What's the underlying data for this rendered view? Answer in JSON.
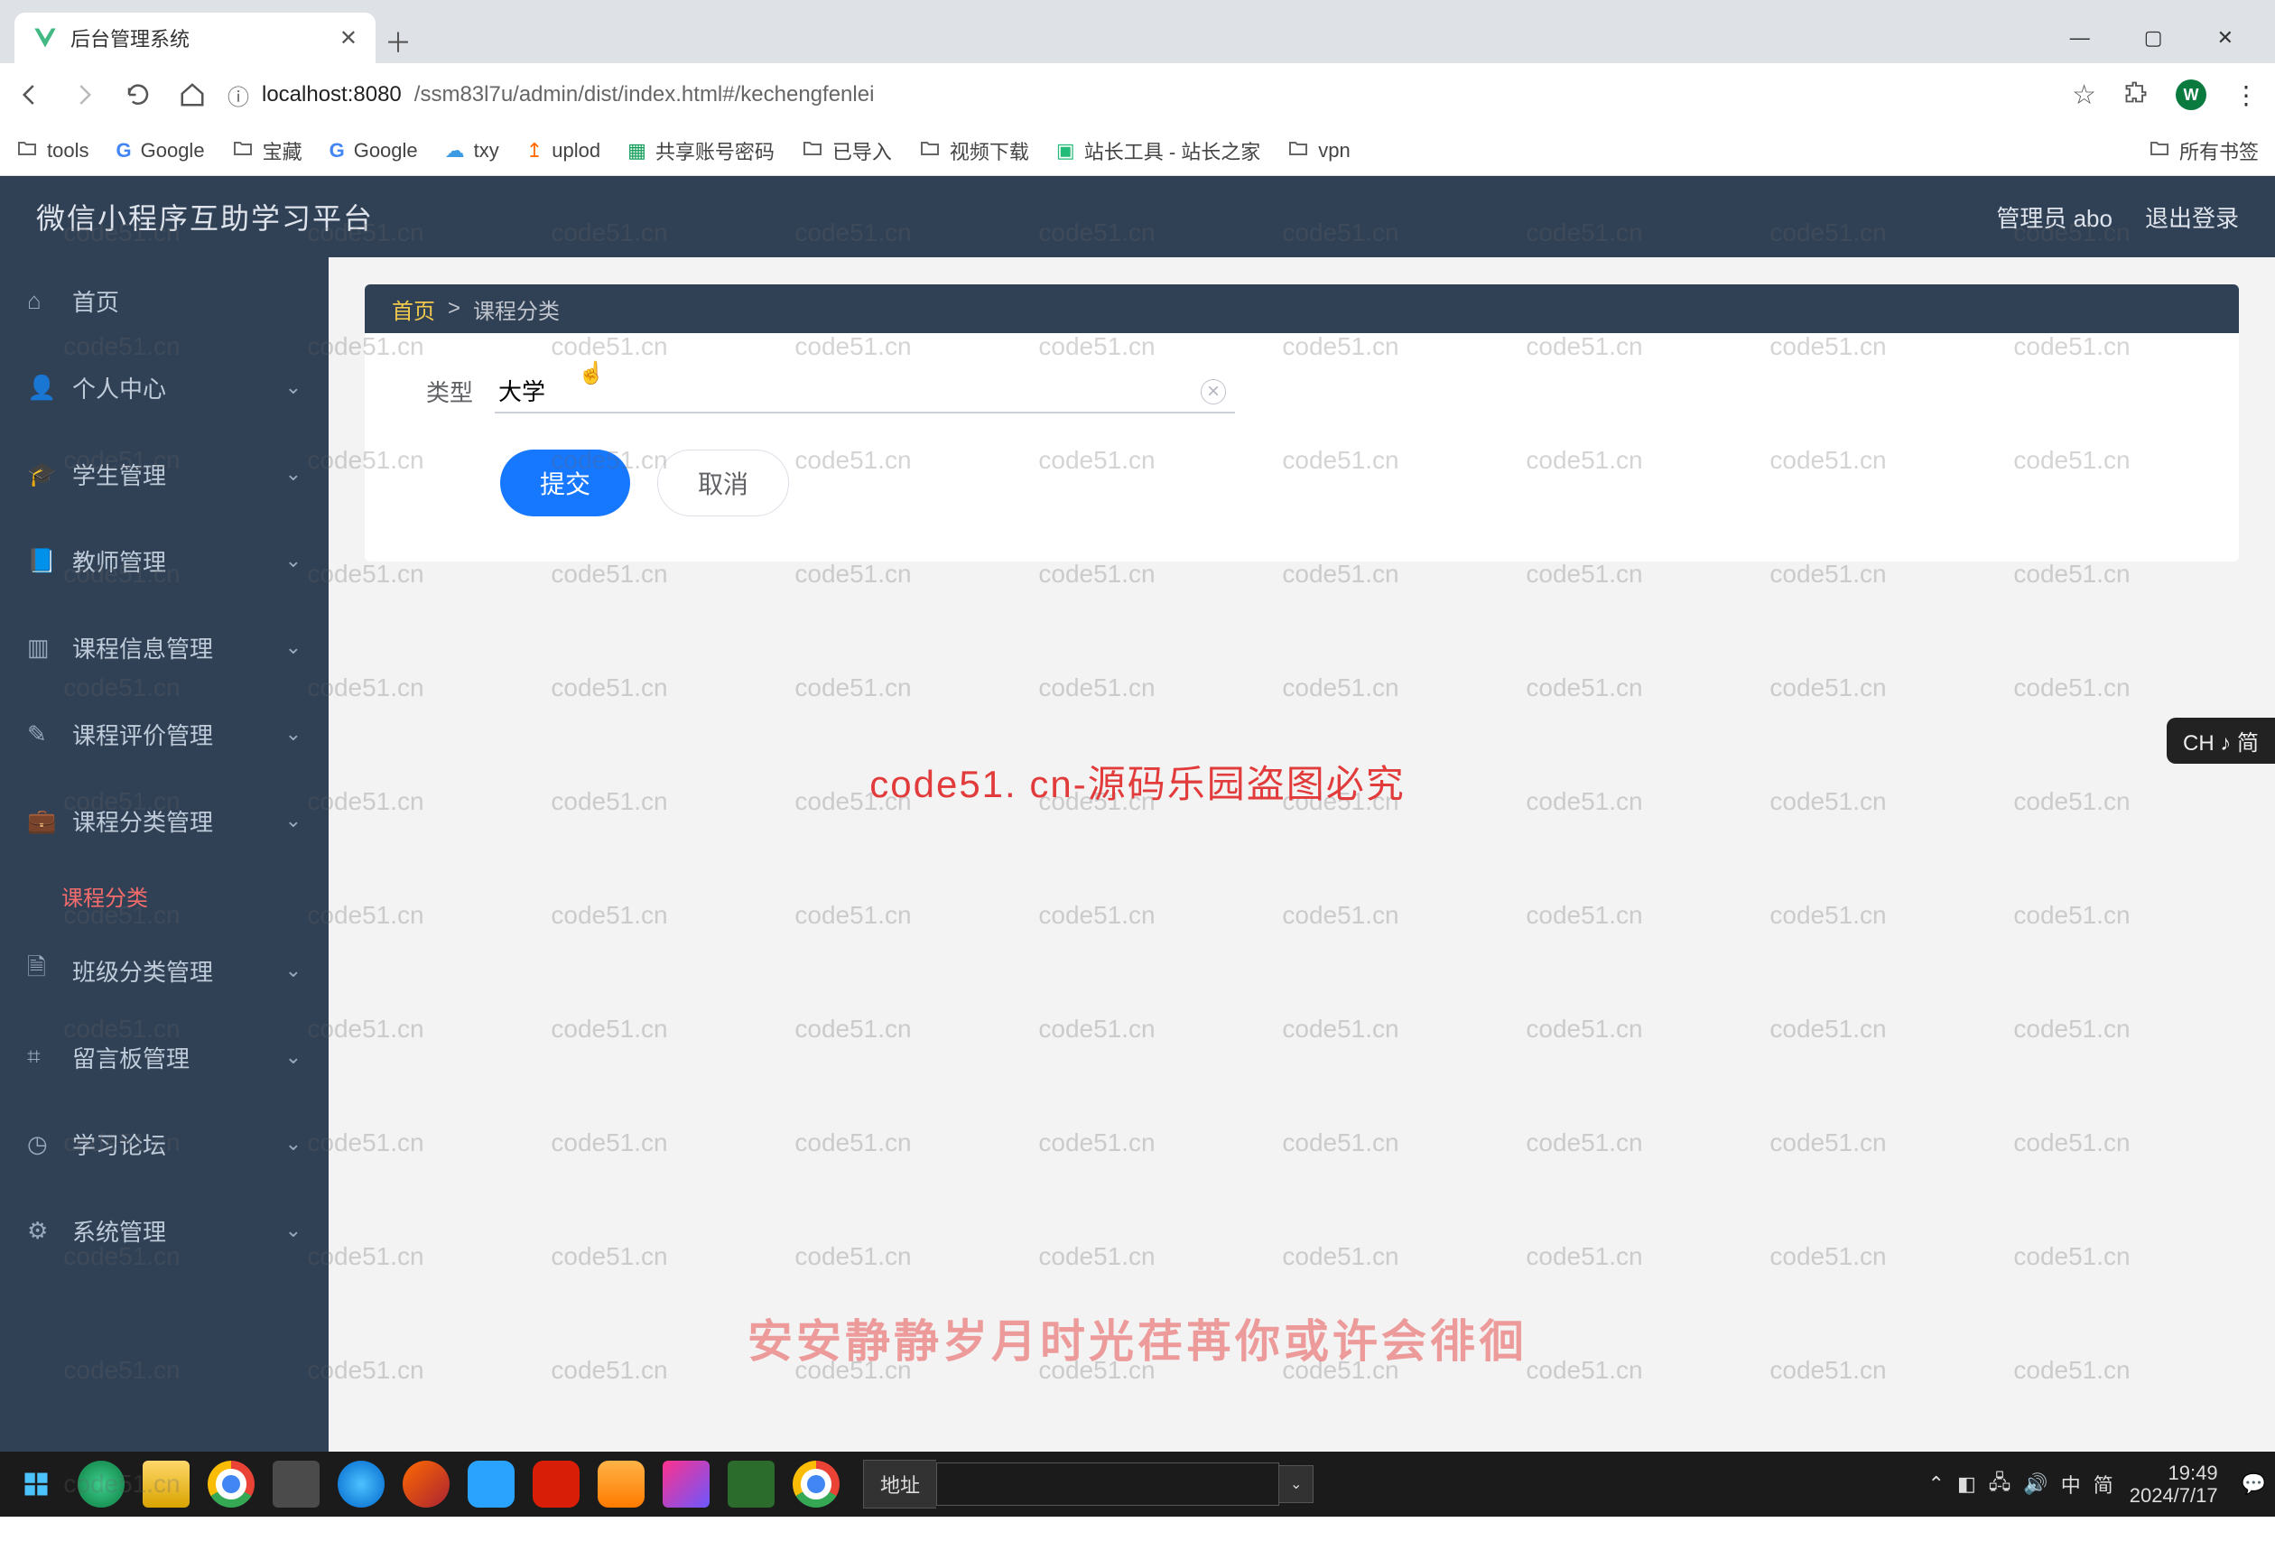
{
  "browser": {
    "tab_title": "后台管理系统",
    "url_host": "localhost:8080",
    "url_path": "/ssm83l7u/admin/dist/index.html#/kechengfenlei",
    "avatar_initial": "W",
    "bookmarks": [
      {
        "icon": "folder",
        "label": "tools"
      },
      {
        "icon": "google-g",
        "label": "Google"
      },
      {
        "icon": "folder",
        "label": "宝藏"
      },
      {
        "icon": "google-g",
        "label": "Google"
      },
      {
        "icon": "cloud",
        "label": "txy"
      },
      {
        "icon": "upload",
        "label": "uplod"
      },
      {
        "icon": "sheet",
        "label": "共享账号密码"
      },
      {
        "icon": "folder",
        "label": "已导入"
      },
      {
        "icon": "folder",
        "label": "视频下载"
      },
      {
        "icon": "site-tool",
        "label": "站长工具 - 站长之家"
      },
      {
        "icon": "folder",
        "label": "vpn"
      }
    ],
    "bookmarks_right": {
      "icon": "folder",
      "label": "所有书签"
    }
  },
  "app": {
    "title": "微信小程序互助学习平台",
    "header_user": "管理员 abo",
    "header_logout": "退出登录",
    "breadcrumb_home": "首页",
    "breadcrumb_sep": ">",
    "breadcrumb_current": "课程分类",
    "sidebar": [
      {
        "icon": "home",
        "label": "首页",
        "expandable": false
      },
      {
        "icon": "user",
        "label": "个人中心",
        "expandable": true
      },
      {
        "icon": "student",
        "label": "学生管理",
        "expandable": true
      },
      {
        "icon": "teacher",
        "label": "教师管理",
        "expandable": true
      },
      {
        "icon": "chart",
        "label": "课程信息管理",
        "expandable": true
      },
      {
        "icon": "review",
        "label": "课程评价管理",
        "expandable": true
      },
      {
        "icon": "case",
        "label": "课程分类管理",
        "expandable": true,
        "expanded": true,
        "children": [
          {
            "label": "课程分类",
            "active": true
          }
        ]
      },
      {
        "icon": "doc",
        "label": "班级分类管理",
        "expandable": true
      },
      {
        "icon": "message",
        "label": "留言板管理",
        "expandable": true
      },
      {
        "icon": "clock",
        "label": "学习论坛",
        "expandable": true
      },
      {
        "icon": "gear",
        "label": "系统管理",
        "expandable": true
      }
    ],
    "form": {
      "label_type": "类型",
      "input_value": "大学",
      "submit": "提交",
      "cancel": "取消"
    },
    "ime_badge": "CH ♪ 简"
  },
  "watermark": {
    "tile": "code51.cn",
    "center": "code51. cn-源码乐园盗图必究",
    "bottom": "安安静静岁月时光荏苒你或许会徘徊"
  },
  "taskbar": {
    "apps": [
      "windows",
      "edge",
      "explorer",
      "chrome",
      "sublime",
      "browser",
      "opera",
      "qq",
      "netease",
      "todesk",
      "jetbrains",
      "intellij",
      "chrome2"
    ],
    "addr_label": "地址",
    "addr_value": "",
    "tray": [
      "chevron",
      "battery",
      "wifi",
      "volume",
      "lang-zh",
      "ime-zhong",
      "keyboard-jian"
    ],
    "lang": "中",
    "ime": "简",
    "time": "19:49",
    "date": "2024/7/17"
  }
}
